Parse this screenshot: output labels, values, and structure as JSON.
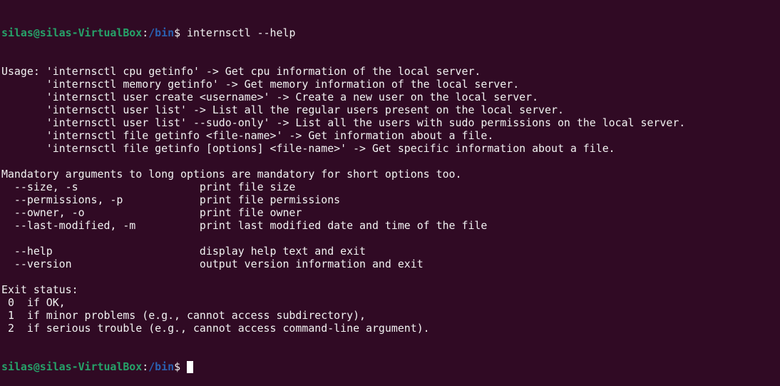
{
  "prompt": {
    "user_host": "silas@silas-VirtualBox",
    "sep": ":",
    "path": "/bin",
    "symbol": "$ "
  },
  "command": "internsctl --help",
  "output": [
    "Usage: 'internsctl cpu getinfo' -> Get cpu information of the local server.",
    "       'internsctl memory getinfo' -> Get memory information of the local server.",
    "       'internsctl user create <username>' -> Create a new user on the local server.",
    "       'internsctl user list' -> List all the regular users present on the local server.",
    "       'internsctl user list' --sudo-only' -> List all the users with sudo permissions on the local server.",
    "       'internsctl file getinfo <file-name>' -> Get information about a file.",
    "       'internsctl file getinfo [options] <file-name>' -> Get specific information about a file.",
    "",
    "Mandatory arguments to long options are mandatory for short options too.",
    "  --size, -s                   print file size",
    "  --permissions, -p            print file permissions",
    "  --owner, -o                  print file owner",
    "  --last-modified, -m          print last modified date and time of the file",
    "",
    "  --help                       display help text and exit",
    "  --version                    output version information and exit",
    "",
    "Exit status:",
    " 0  if OK,",
    " 1  if minor problems (e.g., cannot access subdirectory),",
    " 2  if serious trouble (e.g., cannot access command-line argument)."
  ],
  "colors": {
    "background": "#300a24",
    "user_host": "#26a269",
    "path": "#2a60b0",
    "text": "#f2f2f2"
  }
}
